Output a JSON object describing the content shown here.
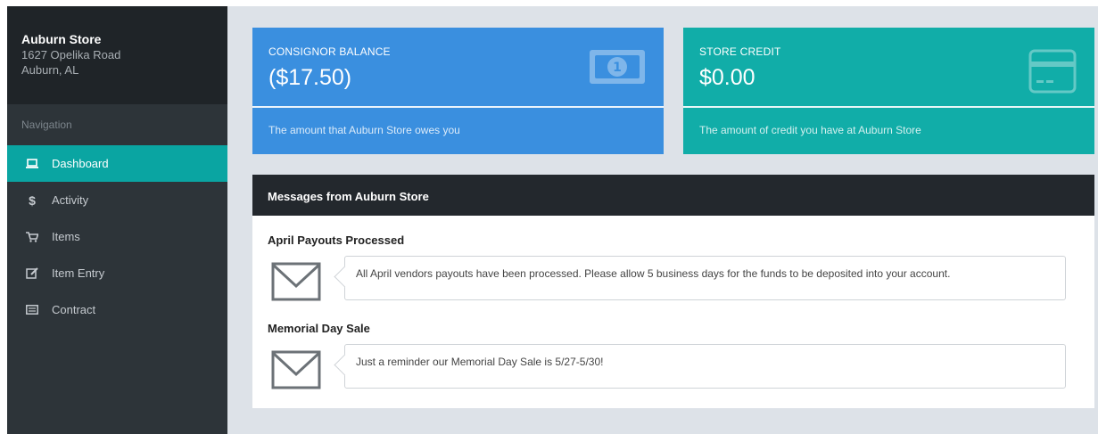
{
  "store": {
    "name": "Auburn Store",
    "address_line1": "1627 Opelika Road",
    "address_line2": "Auburn, AL"
  },
  "nav": {
    "title": "Navigation",
    "items": [
      {
        "label": "Dashboard",
        "icon": "laptop-icon",
        "active": true
      },
      {
        "label": "Activity",
        "icon": "dollar-icon",
        "active": false
      },
      {
        "label": "Items",
        "icon": "cart-icon",
        "active": false
      },
      {
        "label": "Item Entry",
        "icon": "edit-icon",
        "active": false
      },
      {
        "label": "Contract",
        "icon": "list-icon",
        "active": false
      }
    ]
  },
  "cards": {
    "consignor": {
      "label": "CONSIGNOR BALANCE",
      "value": "($17.50)",
      "description": "The amount that Auburn Store owes you",
      "icon": "money-icon",
      "color": "#3a8fdf"
    },
    "credit": {
      "label": "STORE CREDIT",
      "value": "$0.00",
      "description": "The amount of credit you have at Auburn Store",
      "icon": "credit-card-icon",
      "color": "#11ada8"
    }
  },
  "messages": {
    "header": "Messages from Auburn Store",
    "items": [
      {
        "title": "April Payouts Processed",
        "body": "All April vendors payouts have been processed. Please allow 5 business days for the funds to be deposited into your account."
      },
      {
        "title": "Memorial Day Sale",
        "body": "Just a reminder our Memorial Day Sale is 5/27-5/30!"
      }
    ]
  },
  "colors": {
    "sidebar": "#2d3439",
    "sidebar_header": "#1f2428",
    "active": "#0aa5a2",
    "main_bg": "#dde2e8"
  }
}
